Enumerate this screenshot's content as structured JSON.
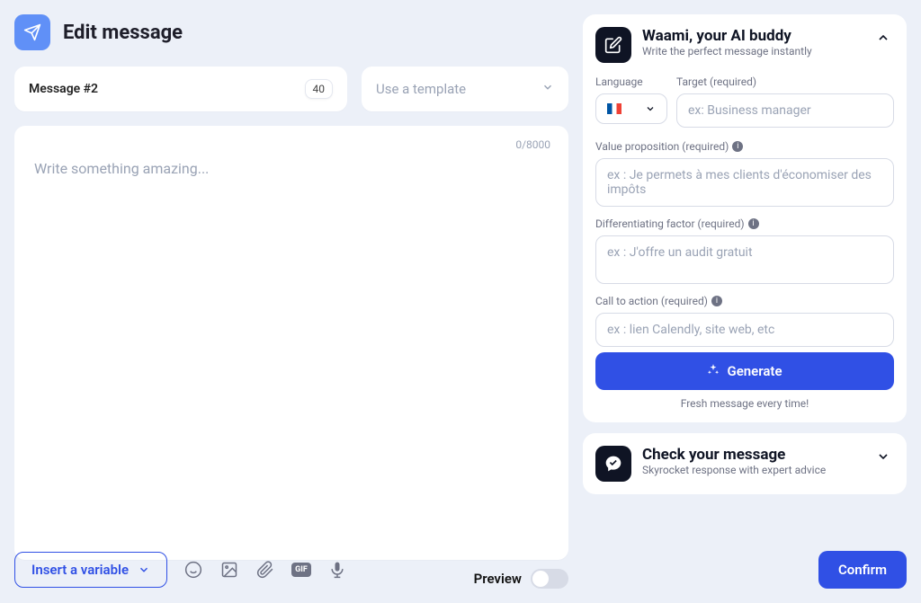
{
  "header": {
    "title": "Edit message"
  },
  "message_row": {
    "label": "Message #2",
    "badge": "40",
    "template_placeholder": "Use a template"
  },
  "editor": {
    "placeholder": "Write something amazing...",
    "char_count": "0/8000"
  },
  "preview": {
    "label": "Preview"
  },
  "bottom": {
    "insert_variable": "Insert a variable",
    "confirm": "Confirm",
    "gif_label": "GIF"
  },
  "ai_panel": {
    "title": "Waami, your AI buddy",
    "subtitle": "Write the perfect message instantly",
    "language_label": "Language",
    "target_label": "Target (required)",
    "target_placeholder": "ex: Business manager",
    "value_prop_label": "Value proposition (required)",
    "value_prop_placeholder": "ex : Je permets à mes clients d'économiser des impôts",
    "diff_label": "Differentiating factor (required)",
    "diff_placeholder": "ex : J'offre un audit gratuit",
    "cta_label": "Call to action (required)",
    "cta_placeholder": "ex : lien Calendly, site web, etc",
    "generate_btn": "Generate",
    "fresh_text": "Fresh message every time!"
  },
  "check_panel": {
    "title": "Check your message",
    "subtitle": "Skyrocket response with expert advice"
  }
}
